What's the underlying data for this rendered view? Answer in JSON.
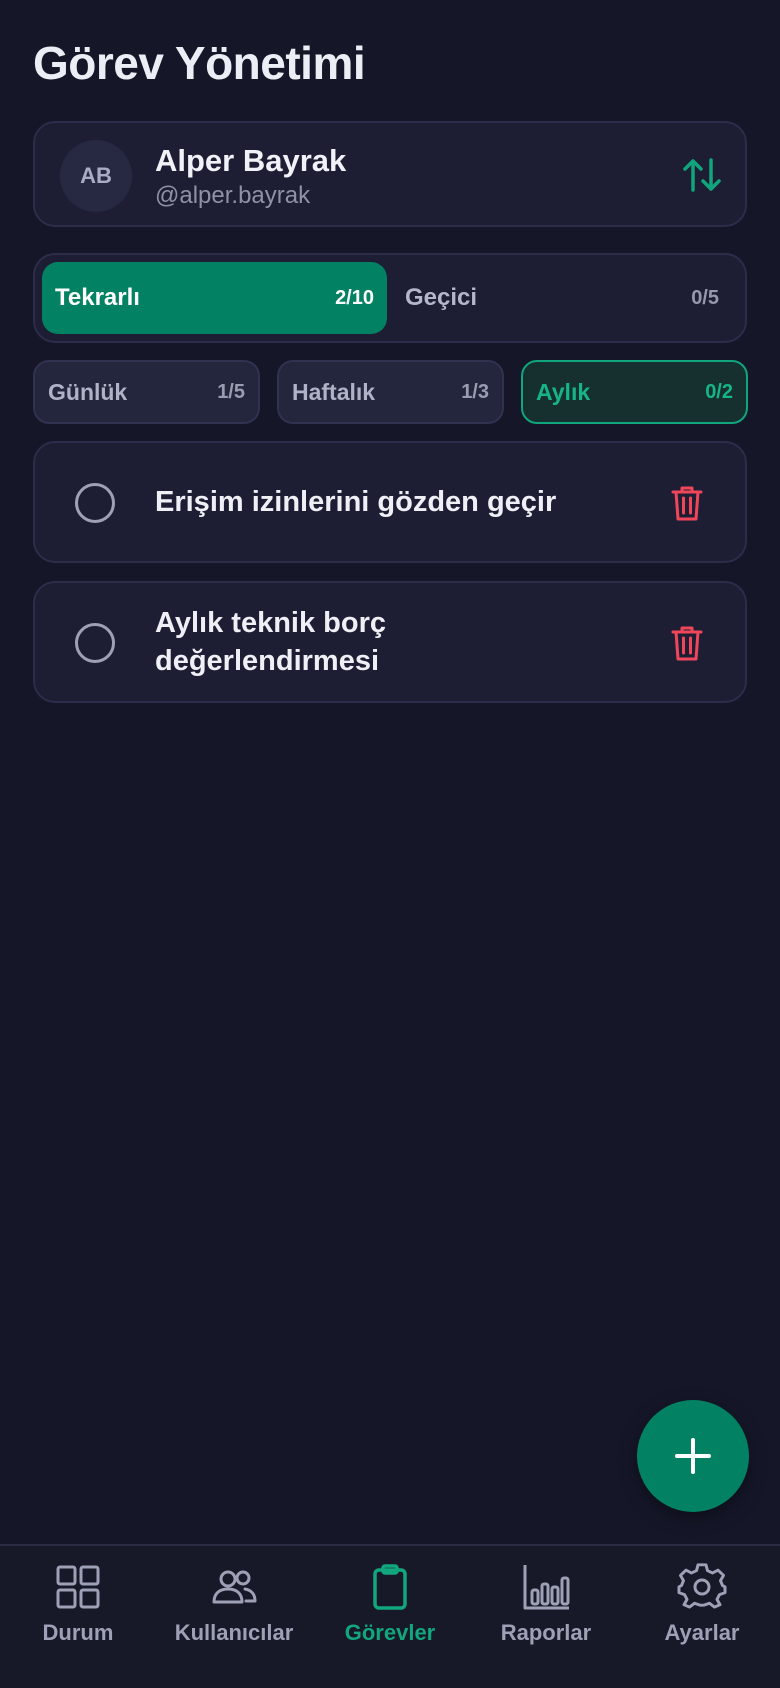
{
  "header": {
    "title": "Görev Yönetimi"
  },
  "user": {
    "initials": "AB",
    "name": "Alper Bayrak",
    "handle": "@alper.bayrak"
  },
  "segments": [
    {
      "label": "Tekrarlı",
      "count": "2/10",
      "active": true
    },
    {
      "label": "Geçici",
      "count": "0/5",
      "active": false
    }
  ],
  "chips": [
    {
      "label": "Günlük",
      "count": "1/5"
    },
    {
      "label": "Haftalık",
      "count": "1/3"
    },
    {
      "label": "Aylık",
      "count": "0/2"
    }
  ],
  "tasks": [
    {
      "text": "Erişim izinlerini gözden geçir"
    },
    {
      "text": "Aylık teknik borç değerlendirmesi"
    }
  ],
  "nav": [
    {
      "label": "Durum",
      "icon": "grid-icon"
    },
    {
      "label": "Kullanıcılar",
      "icon": "users-icon"
    },
    {
      "label": "Görevler",
      "icon": "clipboard-icon"
    },
    {
      "label": "Raporlar",
      "icon": "bar-chart-icon"
    },
    {
      "label": "Ayarlar",
      "icon": "gear-icon"
    }
  ],
  "colors": {
    "accent": "#028262",
    "accent_text": "#12a67d",
    "danger": "#f0465a",
    "background": "#151628",
    "card": "#1d1e34"
  }
}
